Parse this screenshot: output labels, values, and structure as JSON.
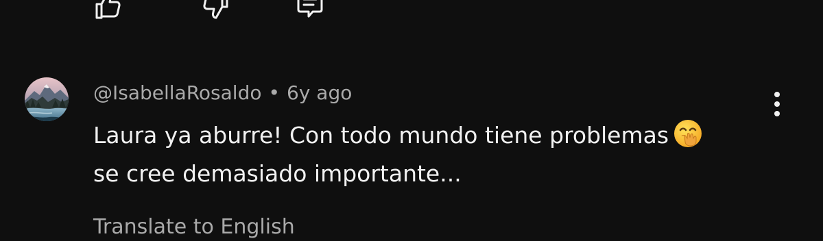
{
  "actions": {
    "like_icon": "thumb-up-icon",
    "dislike_icon": "thumb-down-icon",
    "reply_icon": "comment-icon"
  },
  "comment": {
    "author": "@IsabellaRosaldo",
    "separator": "•",
    "age": "6y ago",
    "text_line1": "Laura ya aburre! Con todo mundo tiene problemas",
    "emoji": "face-with-hand-over-mouth",
    "text_line2": "se cree demasiado importante...",
    "menu_icon": "more-vertical-icon",
    "translate_label": "Translate to English"
  },
  "colors": {
    "background": "#0f0f0f",
    "primary_text": "#f1f1f1",
    "secondary_text": "#aaaaaa"
  }
}
